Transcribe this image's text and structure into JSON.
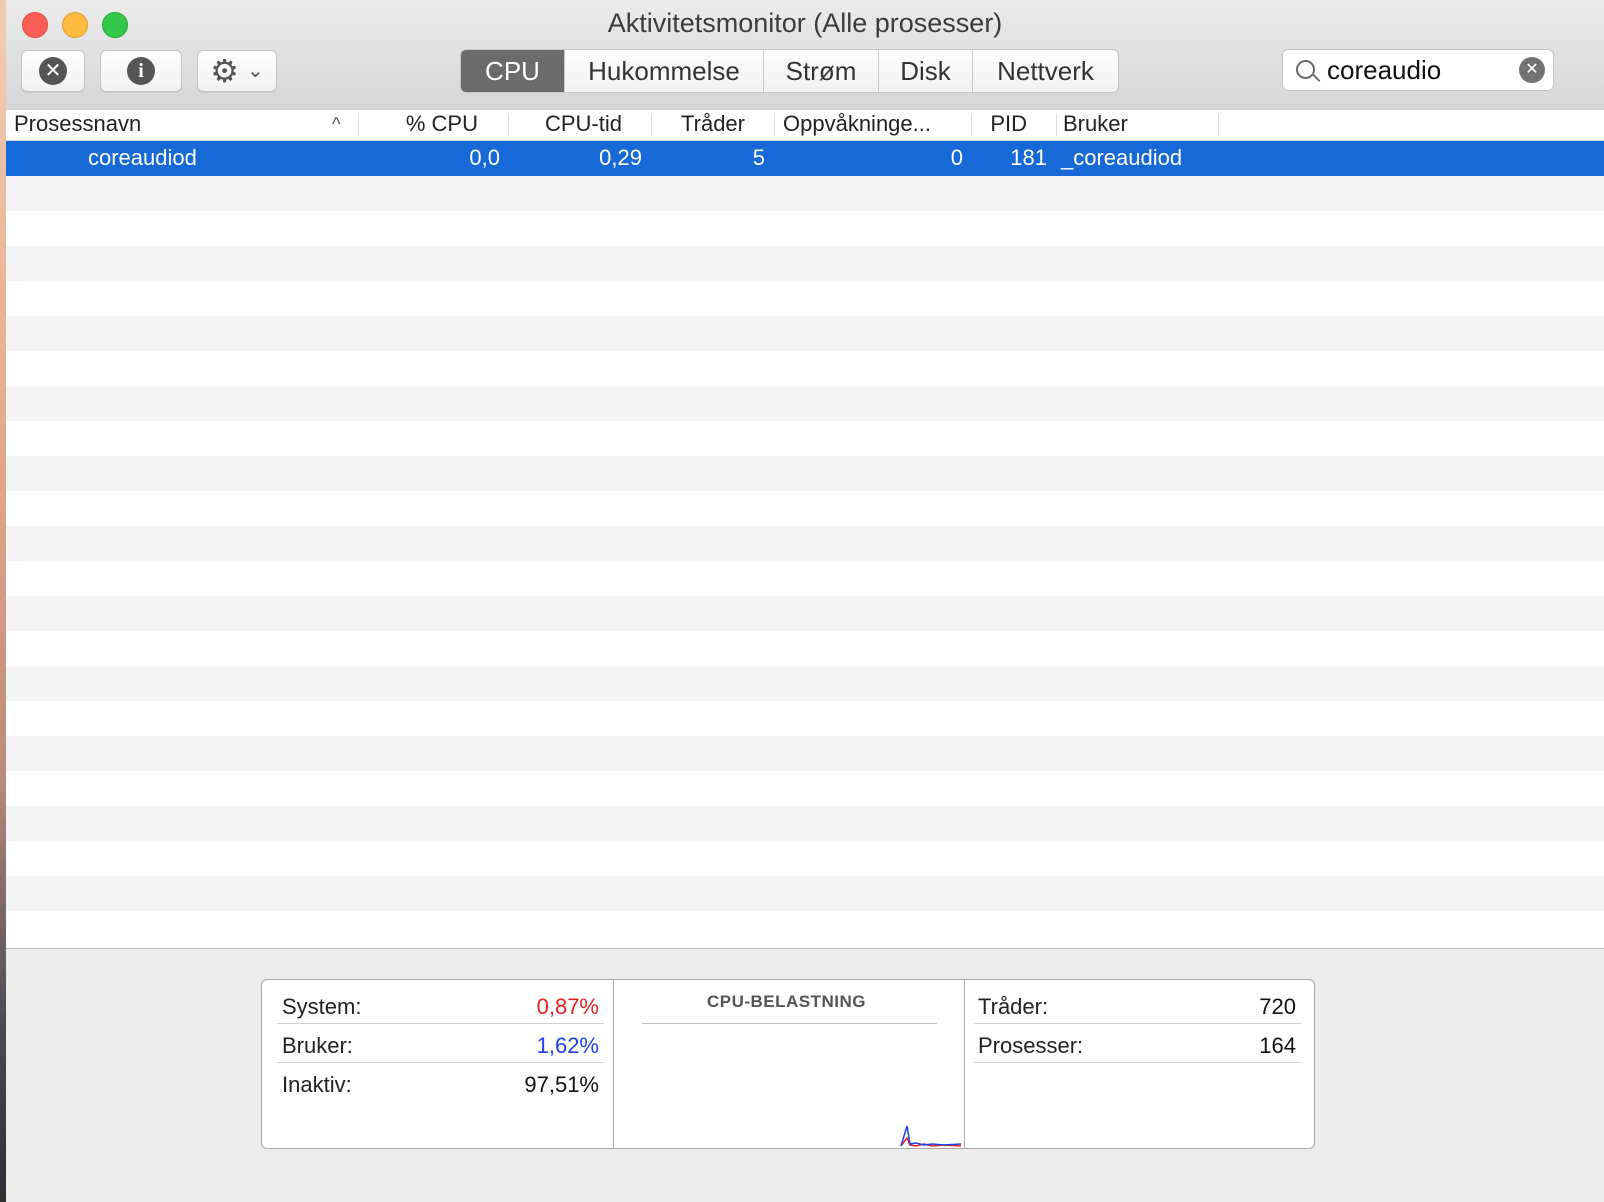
{
  "window": {
    "title": "Aktivitetsmonitor (Alle prosesser)"
  },
  "toolbar": {
    "quit_icon": "close-circle-icon",
    "info_icon": "info-icon",
    "actions_icon": "gear-icon",
    "tabs": [
      {
        "label": "CPU",
        "active": true
      },
      {
        "label": "Hukommelse",
        "active": false
      },
      {
        "label": "Strøm",
        "active": false
      },
      {
        "label": "Disk",
        "active": false
      },
      {
        "label": "Nettverk",
        "active": false
      }
    ],
    "search": {
      "value": "coreaudio",
      "placeholder": "Søk"
    }
  },
  "table": {
    "columns": [
      "Prosessnavn",
      "% CPU",
      "CPU-tid",
      "Tråder",
      "Oppvåkninge...",
      "PID",
      "Bruker"
    ],
    "sort_column": "Prosessnavn",
    "sort_direction": "ascending",
    "rows": [
      {
        "name": "coreaudiod",
        "cpu": "0,0",
        "cpu_time": "0,29",
        "threads": "5",
        "wakeups": "0",
        "pid": "181",
        "user": "_coreaudiod",
        "selected": true
      }
    ]
  },
  "stats": {
    "left": [
      {
        "label": "System:",
        "value": "0,87%",
        "color": "#e82020"
      },
      {
        "label": "Bruker:",
        "value": "1,62%",
        "color": "#1f3fe6"
      },
      {
        "label": "Inaktiv:",
        "value": "97,51%",
        "color": "#111111"
      }
    ],
    "graph_title": "CPU-BELASTNING",
    "right": [
      {
        "label": "Tråder:",
        "value": "720"
      },
      {
        "label": "Prosesser:",
        "value": "164"
      }
    ]
  },
  "colors": {
    "selection": "#1669d6",
    "system": "#e82020",
    "user": "#1f3fe6"
  }
}
